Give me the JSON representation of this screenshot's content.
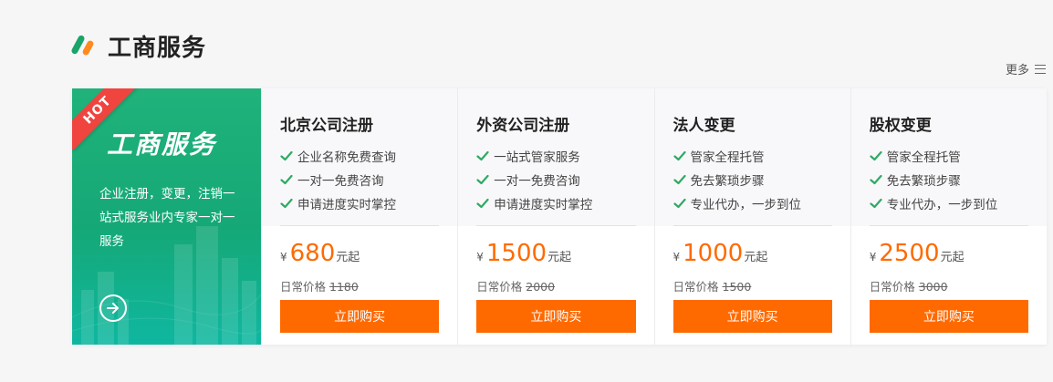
{
  "section": {
    "title": "工商服务",
    "more_label": "更多"
  },
  "banner": {
    "hot_label": "HOT",
    "title": "工商服务",
    "description": "企业注册，变更，注销一站式服务业内专家一对一服务"
  },
  "colors": {
    "accent_orange": "#ff6a00",
    "brand_green": "#1aa36b",
    "check_green": "#2faa63",
    "hot_red": "#f0443f"
  },
  "cards": [
    {
      "name": "北京公司注册",
      "features": [
        "企业名称免费查询",
        "一对一免费咨询",
        "申请进度实时掌控"
      ],
      "currency": "¥",
      "price": "680",
      "price_unit": "元起",
      "regular_label": "日常价格",
      "regular_price": "1180",
      "button_label": "立即购买"
    },
    {
      "name": "外资公司注册",
      "features": [
        "一站式管家服务",
        "一对一免费咨询",
        "申请进度实时掌控"
      ],
      "currency": "¥",
      "price": "1500",
      "price_unit": "元起",
      "regular_label": "日常价格",
      "regular_price": "2000",
      "button_label": "立即购买"
    },
    {
      "name": "法人变更",
      "features": [
        "管家全程托管",
        "免去繁琐步骤",
        "专业代办，一步到位"
      ],
      "currency": "¥",
      "price": "1000",
      "price_unit": "元起",
      "regular_label": "日常价格",
      "regular_price": "1500",
      "button_label": "立即购买"
    },
    {
      "name": "股权变更",
      "features": [
        "管家全程托管",
        "免去繁琐步骤",
        "专业代办，一步到位"
      ],
      "currency": "¥",
      "price": "2500",
      "price_unit": "元起",
      "regular_label": "日常价格",
      "regular_price": "3000",
      "button_label": "立即购买"
    }
  ]
}
